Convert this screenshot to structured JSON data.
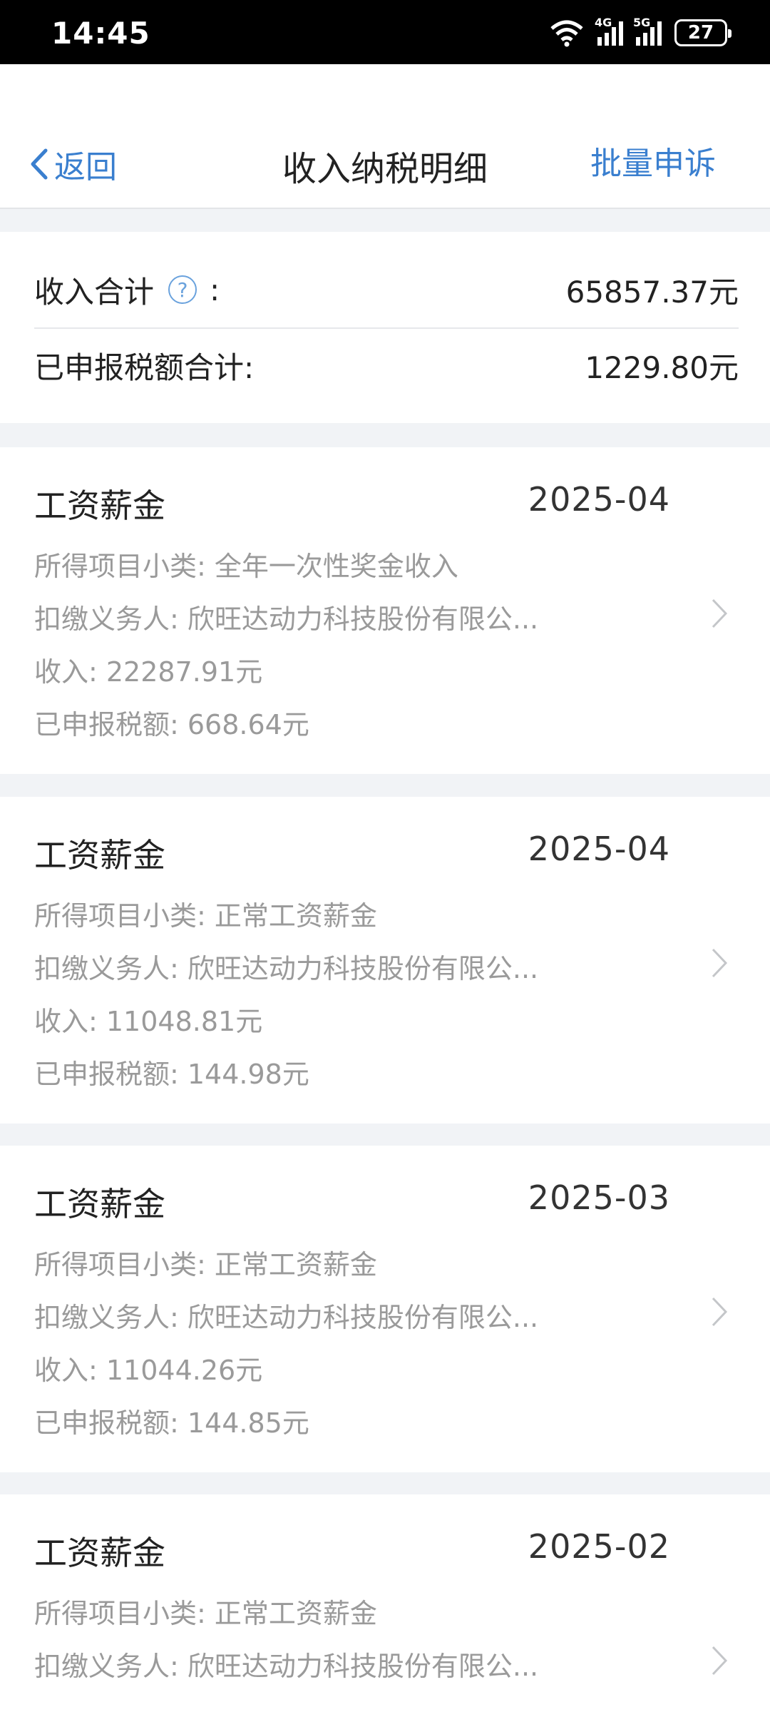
{
  "status": {
    "time": "14:45",
    "battery": "27"
  },
  "nav": {
    "back_label": "返回",
    "title": "收入纳税明细",
    "batch_label": "批量申诉"
  },
  "summary": {
    "income_label": "收入合计",
    "income_colon": ":",
    "income_value": "65857.37元",
    "tax_label": "已申报税额合计:",
    "tax_value": "1229.80元"
  },
  "records": [
    {
      "title": "工资薪金",
      "date": "2025-04",
      "subcategory": "所得项目小类: 全年一次性奖金收入",
      "payer": "扣缴义务人: 欣旺达动力科技股份有限公...",
      "income": "收入: 22287.91元",
      "tax": "已申报税额: 668.64元"
    },
    {
      "title": "工资薪金",
      "date": "2025-04",
      "subcategory": "所得项目小类: 正常工资薪金",
      "payer": "扣缴义务人: 欣旺达动力科技股份有限公...",
      "income": "收入: 11048.81元",
      "tax": "已申报税额: 144.98元"
    },
    {
      "title": "工资薪金",
      "date": "2025-03",
      "subcategory": "所得项目小类: 正常工资薪金",
      "payer": "扣缴义务人: 欣旺达动力科技股份有限公...",
      "income": "收入: 11044.26元",
      "tax": "已申报税额: 144.85元"
    },
    {
      "title": "工资薪金",
      "date": "2025-02",
      "subcategory": "所得项目小类: 正常工资薪金",
      "payer": "扣缴义务人: 欣旺达动力科技股份有限公..."
    }
  ]
}
